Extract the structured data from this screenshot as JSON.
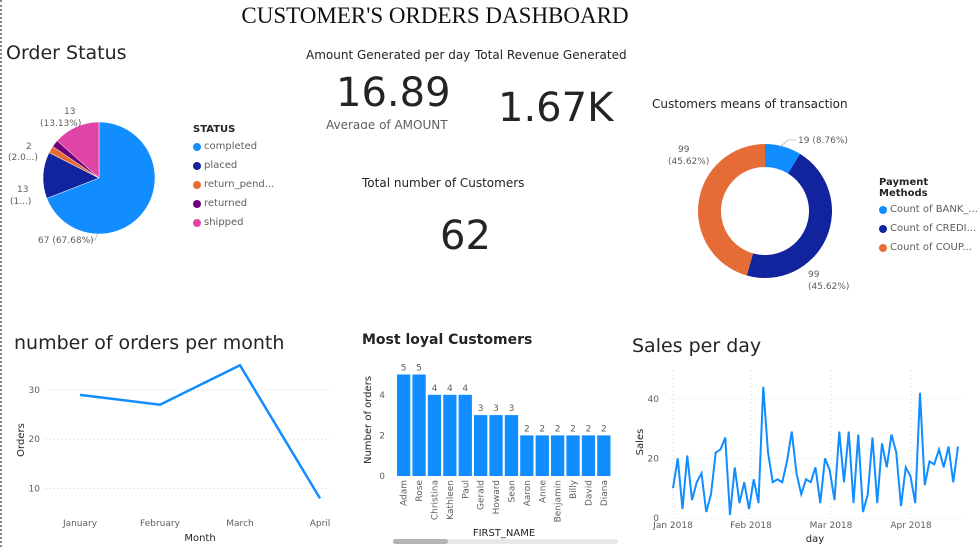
{
  "title": "CUSTOMER'S ORDERS DASHBOARD",
  "colors": {
    "blue": "#118DFF",
    "navy": "#12239E",
    "orange": "#E66C37",
    "purple": "#6B007B",
    "pink": "#E044A7"
  },
  "order_status": {
    "title": "Order Status",
    "legend_title": "STATUS",
    "legend": [
      "completed",
      "placed",
      "return_pend...",
      "returned",
      "shipped"
    ],
    "labels": {
      "completed": "67 (67.68%)",
      "placed_count": "13",
      "placed_pct": "(1...)",
      "return_count": "2",
      "return_pct": "(2.0...)",
      "shipped_count": "13",
      "shipped_pct": "(13.13%)"
    }
  },
  "amount_per_day": {
    "title": "Amount Generated per day",
    "value": "16.89",
    "sub": "Average of AMOUNT"
  },
  "total_revenue": {
    "title": "Total Revenue Generated",
    "value": "1.67K"
  },
  "total_customers": {
    "title": "Total number of Customers",
    "value": "62"
  },
  "transaction": {
    "title": "Customers means of transaction",
    "legend_title": "Payment Methods",
    "legend": [
      "Count of BANK_...",
      "Count of CREDI...",
      "Count of COUP..."
    ],
    "labels": {
      "bank": "19 (8.76%)",
      "credit_count": "99",
      "credit_pct": "(45.62%)",
      "coupon_count": "99",
      "coupon_pct": "(45.62%)"
    }
  },
  "orders_per_month": {
    "title": "number of orders per month",
    "xlabel": "Month",
    "ylabel": "Orders"
  },
  "loyal": {
    "title": "Most loyal Customers",
    "xlabel": "FIRST_NAME",
    "ylabel": "Number of orders"
  },
  "sales_per_day": {
    "title": "Sales per day",
    "xlabel": "day",
    "ylabel": "Sales"
  },
  "chart_data": [
    {
      "type": "pie",
      "title": "Order Status",
      "categories": [
        "completed",
        "placed",
        "return_pend...",
        "returned",
        "shipped"
      ],
      "values": [
        67,
        13,
        2,
        2,
        13
      ]
    },
    {
      "type": "pie",
      "title": "Customers means of transaction",
      "categories": [
        "Count of BANK_...",
        "Count of CREDI...",
        "Count of COUP..."
      ],
      "values": [
        19,
        99,
        99
      ]
    },
    {
      "type": "line",
      "title": "number of orders per month",
      "categories": [
        "January",
        "February",
        "March",
        "April"
      ],
      "values": [
        29,
        27,
        35,
        8
      ],
      "xlabel": "Month",
      "ylabel": "Orders",
      "yticks": [
        10,
        20,
        30
      ]
    },
    {
      "type": "bar",
      "title": "Most loyal Customers",
      "categories": [
        "Adam",
        "Rose",
        "Christina",
        "Kathleen",
        "Paul",
        "Gerald",
        "Howard",
        "Sean",
        "Aaron",
        "Anne",
        "Benjamin",
        "Billy",
        "David",
        "Diana"
      ],
      "values": [
        5,
        5,
        4,
        4,
        4,
        3,
        3,
        3,
        2,
        2,
        2,
        2,
        2,
        2
      ],
      "xlabel": "FIRST_NAME",
      "ylabel": "Number of orders",
      "yticks": [
        0,
        2,
        4
      ]
    },
    {
      "type": "line",
      "title": "Sales per day",
      "xlabel": "day",
      "ylabel": "Sales",
      "xticks": [
        "Jan 2018",
        "Feb 2018",
        "Mar 2018",
        "Apr 2018"
      ],
      "yticks": [
        0,
        20,
        40
      ],
      "ylim": [
        0,
        48
      ],
      "values": [
        10,
        20,
        3,
        21,
        6,
        12,
        15,
        2,
        8,
        22,
        23,
        27,
        1,
        17,
        5,
        12,
        3,
        13,
        5,
        44,
        22,
        12,
        13,
        12,
        19,
        29,
        15,
        8,
        13,
        12,
        17,
        5,
        20,
        16,
        6,
        29,
        12,
        29,
        5,
        28,
        2,
        8,
        27,
        5,
        25,
        17,
        28,
        22,
        4,
        17,
        14,
        5,
        42,
        11,
        19,
        18,
        23,
        17,
        24,
        12,
        24
      ]
    }
  ]
}
